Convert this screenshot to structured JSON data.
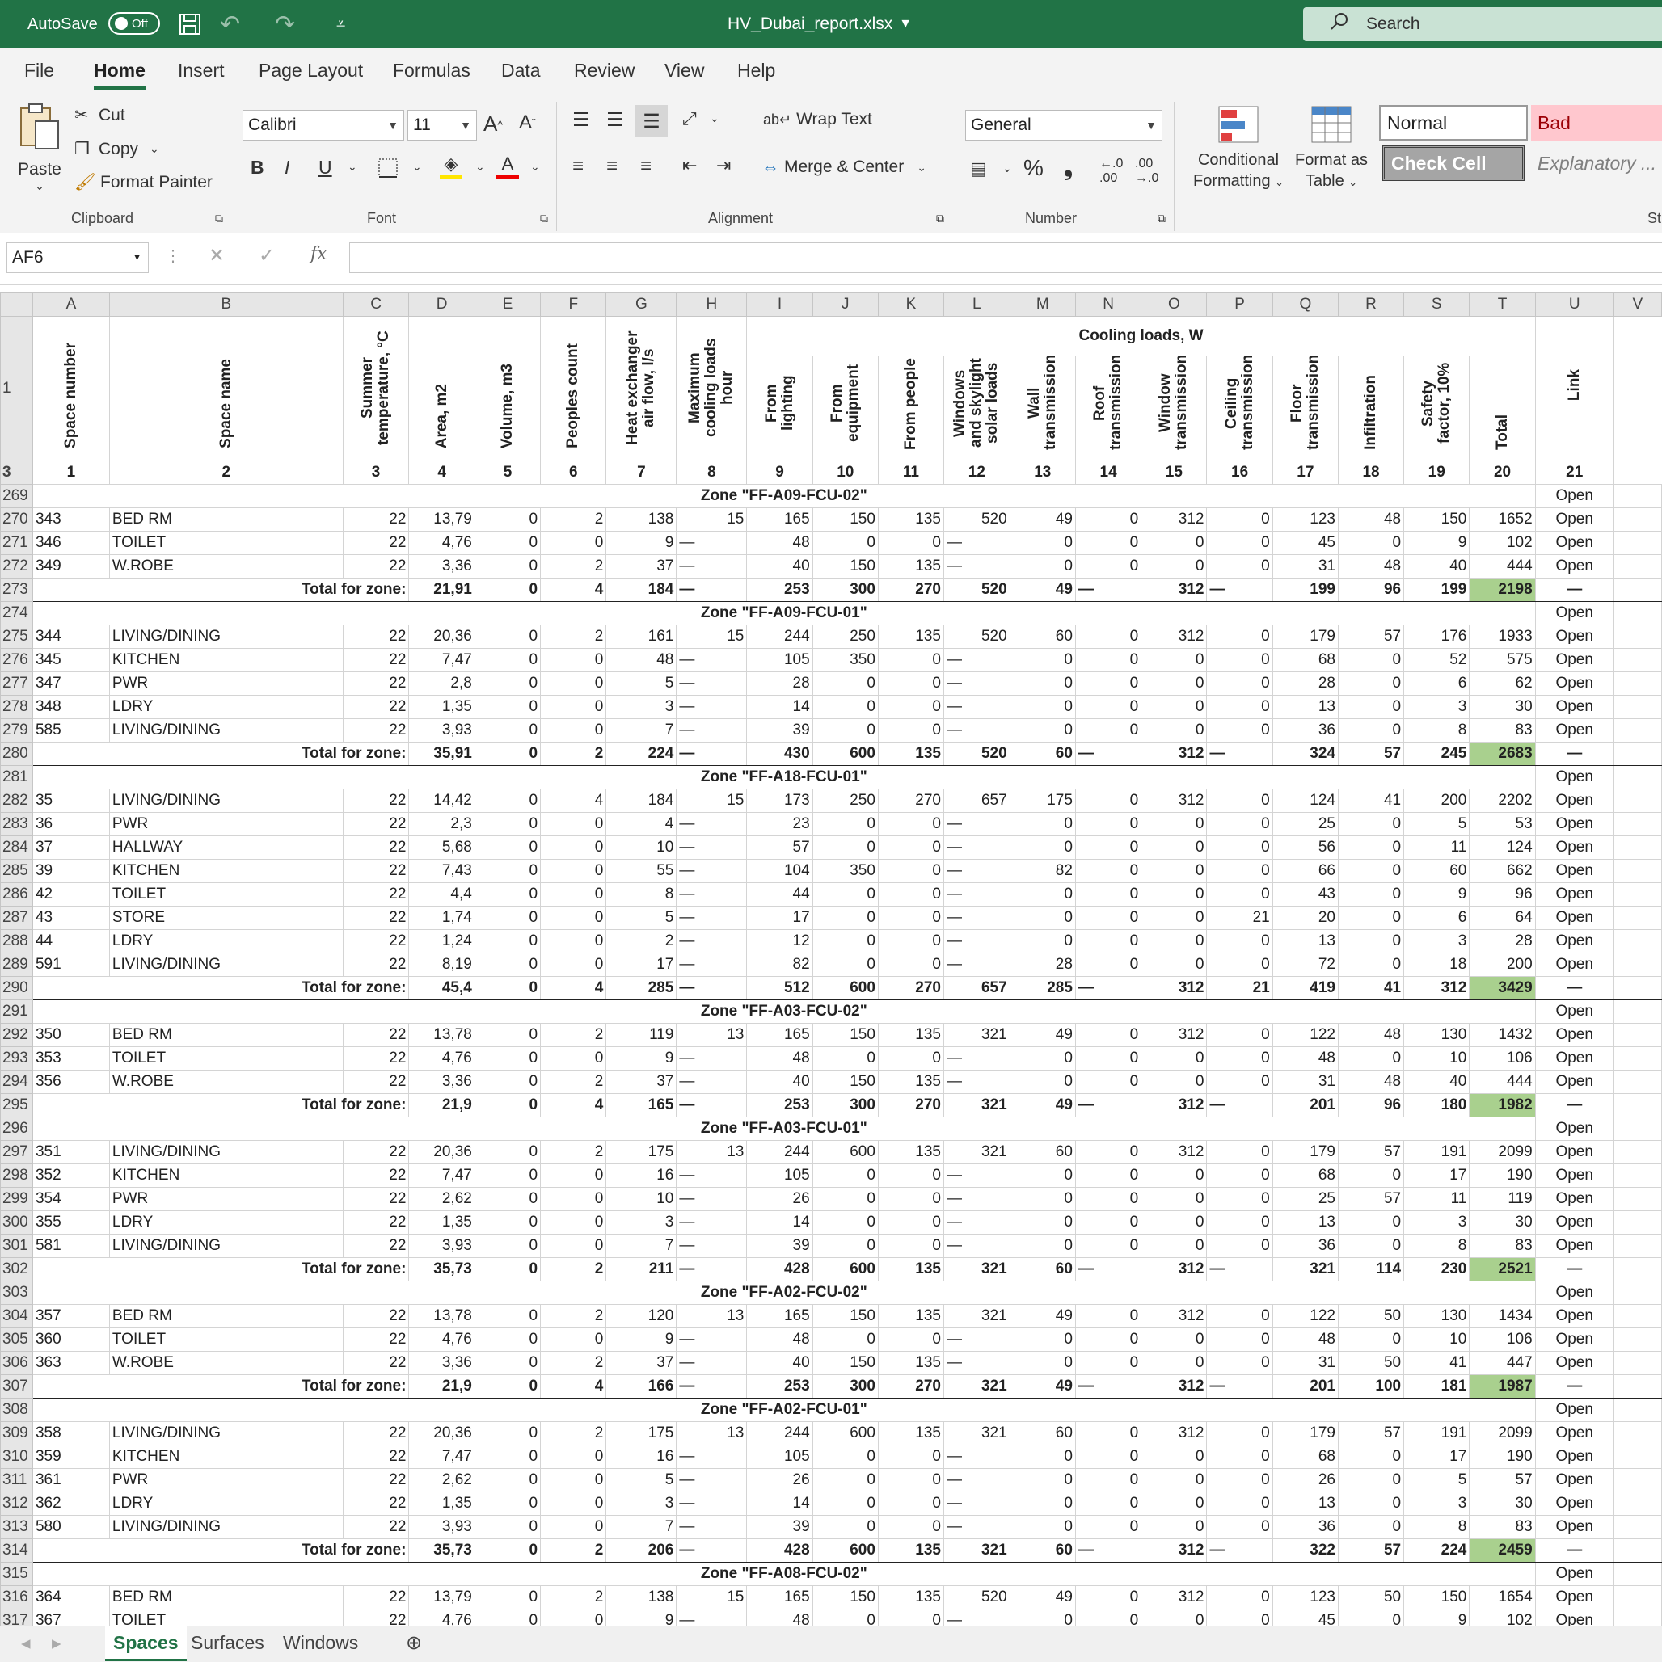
{
  "titlebar": {
    "autosave_label": "AutoSave",
    "autosave_state": "Off",
    "filename": "HV_Dubai_report.xlsx",
    "search_placeholder": "Search"
  },
  "tabs": [
    "File",
    "Home",
    "Insert",
    "Page Layout",
    "Formulas",
    "Data",
    "Review",
    "View",
    "Help"
  ],
  "ribbon": {
    "clipboard": {
      "paste": "Paste",
      "cut": "Cut",
      "copy": "Copy",
      "format_painter": "Format Painter",
      "label": "Clipboard"
    },
    "font": {
      "name": "Calibri",
      "size": "11",
      "label": "Font"
    },
    "alignment": {
      "wrap_text": "Wrap Text",
      "merge_center": "Merge & Center",
      "label": "Alignment"
    },
    "number": {
      "format": "General",
      "label": "Number"
    },
    "styles": {
      "conditional": "Conditional",
      "conditional2": "Formatting",
      "format_as": "Format as",
      "format_as2": "Table",
      "normal": "Normal",
      "bad": "Bad",
      "check_cell": "Check Cell",
      "explanatory": "Explanatory ...",
      "partial": "St"
    }
  },
  "formula": {
    "namebox": "AF6",
    "content": ""
  },
  "columns": [
    "A",
    "B",
    "C",
    "D",
    "E",
    "F",
    "G",
    "H",
    "I",
    "J",
    "K",
    "L",
    "M",
    "N",
    "O",
    "P",
    "Q",
    "R",
    "S",
    "T",
    "U",
    "V"
  ],
  "header": {
    "cooling": "Cooling loads, W",
    "labels": [
      "Space number",
      "Space name",
      "Summer temperature, °C",
      "Area, m2",
      "Volume, m3",
      "Peoples count",
      "Heat exchanger air flow, l/s",
      "Maximum cooling loads hour",
      "From lighting",
      "From equipment",
      "From people",
      "Windows and skylight solar loads",
      "Wall transmission",
      "Roof transmission",
      "Window transmission",
      "Ceiling transmission",
      "Floor transmission",
      "Infiltration",
      "Safety factor, 10%",
      "Total",
      "Link"
    ],
    "numbers": [
      "1",
      "2",
      "3",
      "4",
      "5",
      "6",
      "7",
      "8",
      "9",
      "10",
      "11",
      "12",
      "13",
      "14",
      "15",
      "16",
      "17",
      "18",
      "19",
      "20",
      "21"
    ]
  },
  "rows": [
    {
      "n": "269",
      "type": "zone",
      "title": "Zone \"FF-A09-FCU-02\"",
      "link": "Open"
    },
    {
      "n": "270",
      "type": "data",
      "v": [
        "343",
        "BED RM",
        "22",
        "13,79",
        "0",
        "2",
        "138",
        "15",
        "165",
        "150",
        "135",
        "520",
        "49",
        "0",
        "312",
        "0",
        "123",
        "48",
        "150",
        "1652",
        "Open"
      ]
    },
    {
      "n": "271",
      "type": "data",
      "v": [
        "346",
        "TOILET",
        "22",
        "4,76",
        "0",
        "0",
        "9",
        "—",
        "48",
        "0",
        "0",
        "—",
        "0",
        "0",
        "0",
        "0",
        "45",
        "0",
        "9",
        "102",
        "Open"
      ]
    },
    {
      "n": "272",
      "type": "data",
      "v": [
        "349",
        "W.ROBE",
        "22",
        "3,36",
        "0",
        "2",
        "37",
        "—",
        "40",
        "150",
        "135",
        "—",
        "0",
        "0",
        "0",
        "0",
        "31",
        "48",
        "40",
        "444",
        "Open"
      ]
    },
    {
      "n": "273",
      "type": "total",
      "label": "Total for zone:",
      "v": [
        "21,91",
        "0",
        "4",
        "184",
        "—",
        "253",
        "300",
        "270",
        "520",
        "49",
        "—",
        "312",
        "—",
        "199",
        "96",
        "199",
        "2198",
        "—"
      ]
    },
    {
      "n": "274",
      "type": "zone",
      "title": "Zone \"FF-A09-FCU-01\"",
      "link": "Open"
    },
    {
      "n": "275",
      "type": "data",
      "v": [
        "344",
        "LIVING/DINING",
        "22",
        "20,36",
        "0",
        "2",
        "161",
        "15",
        "244",
        "250",
        "135",
        "520",
        "60",
        "0",
        "312",
        "0",
        "179",
        "57",
        "176",
        "1933",
        "Open"
      ]
    },
    {
      "n": "276",
      "type": "data",
      "v": [
        "345",
        "KITCHEN",
        "22",
        "7,47",
        "0",
        "0",
        "48",
        "—",
        "105",
        "350",
        "0",
        "—",
        "0",
        "0",
        "0",
        "0",
        "68",
        "0",
        "52",
        "575",
        "Open"
      ]
    },
    {
      "n": "277",
      "type": "data",
      "v": [
        "347",
        "PWR",
        "22",
        "2,8",
        "0",
        "0",
        "5",
        "—",
        "28",
        "0",
        "0",
        "—",
        "0",
        "0",
        "0",
        "0",
        "28",
        "0",
        "6",
        "62",
        "Open"
      ]
    },
    {
      "n": "278",
      "type": "data",
      "v": [
        "348",
        "LDRY",
        "22",
        "1,35",
        "0",
        "0",
        "3",
        "—",
        "14",
        "0",
        "0",
        "—",
        "0",
        "0",
        "0",
        "0",
        "13",
        "0",
        "3",
        "30",
        "Open"
      ]
    },
    {
      "n": "279",
      "type": "data",
      "v": [
        "585",
        "LIVING/DINING",
        "22",
        "3,93",
        "0",
        "0",
        "7",
        "—",
        "39",
        "0",
        "0",
        "—",
        "0",
        "0",
        "0",
        "0",
        "36",
        "0",
        "8",
        "83",
        "Open"
      ]
    },
    {
      "n": "280",
      "type": "total",
      "label": "Total for zone:",
      "v": [
        "35,91",
        "0",
        "2",
        "224",
        "—",
        "430",
        "600",
        "135",
        "520",
        "60",
        "—",
        "312",
        "—",
        "324",
        "57",
        "245",
        "2683",
        "—"
      ]
    },
    {
      "n": "281",
      "type": "zone",
      "title": "Zone \"FF-A18-FCU-01\"",
      "link": "Open"
    },
    {
      "n": "282",
      "type": "data",
      "v": [
        "35",
        "LIVING/DINING",
        "22",
        "14,42",
        "0",
        "4",
        "184",
        "15",
        "173",
        "250",
        "270",
        "657",
        "175",
        "0",
        "312",
        "0",
        "124",
        "41",
        "200",
        "2202",
        "Open"
      ]
    },
    {
      "n": "283",
      "type": "data",
      "v": [
        "36",
        "PWR",
        "22",
        "2,3",
        "0",
        "0",
        "4",
        "—",
        "23",
        "0",
        "0",
        "—",
        "0",
        "0",
        "0",
        "0",
        "25",
        "0",
        "5",
        "53",
        "Open"
      ]
    },
    {
      "n": "284",
      "type": "data",
      "v": [
        "37",
        "HALLWAY",
        "22",
        "5,68",
        "0",
        "0",
        "10",
        "—",
        "57",
        "0",
        "0",
        "—",
        "0",
        "0",
        "0",
        "0",
        "56",
        "0",
        "11",
        "124",
        "Open"
      ]
    },
    {
      "n": "285",
      "type": "data",
      "v": [
        "39",
        "KITCHEN",
        "22",
        "7,43",
        "0",
        "0",
        "55",
        "—",
        "104",
        "350",
        "0",
        "—",
        "82",
        "0",
        "0",
        "0",
        "66",
        "0",
        "60",
        "662",
        "Open"
      ]
    },
    {
      "n": "286",
      "type": "data",
      "v": [
        "42",
        "TOILET",
        "22",
        "4,4",
        "0",
        "0",
        "8",
        "—",
        "44",
        "0",
        "0",
        "—",
        "0",
        "0",
        "0",
        "0",
        "43",
        "0",
        "9",
        "96",
        "Open"
      ]
    },
    {
      "n": "287",
      "type": "data",
      "v": [
        "43",
        "STORE",
        "22",
        "1,74",
        "0",
        "0",
        "5",
        "—",
        "17",
        "0",
        "0",
        "—",
        "0",
        "0",
        "0",
        "21",
        "20",
        "0",
        "6",
        "64",
        "Open"
      ]
    },
    {
      "n": "288",
      "type": "data",
      "v": [
        "44",
        "LDRY",
        "22",
        "1,24",
        "0",
        "0",
        "2",
        "—",
        "12",
        "0",
        "0",
        "—",
        "0",
        "0",
        "0",
        "0",
        "13",
        "0",
        "3",
        "28",
        "Open"
      ]
    },
    {
      "n": "289",
      "type": "data",
      "v": [
        "591",
        "LIVING/DINING",
        "22",
        "8,19",
        "0",
        "0",
        "17",
        "—",
        "82",
        "0",
        "0",
        "—",
        "28",
        "0",
        "0",
        "0",
        "72",
        "0",
        "18",
        "200",
        "Open"
      ]
    },
    {
      "n": "290",
      "type": "total",
      "label": "Total for zone:",
      "v": [
        "45,4",
        "0",
        "4",
        "285",
        "—",
        "512",
        "600",
        "270",
        "657",
        "285",
        "—",
        "312",
        "21",
        "419",
        "41",
        "312",
        "3429",
        "—"
      ]
    },
    {
      "n": "291",
      "type": "zone",
      "title": "Zone \"FF-A03-FCU-02\"",
      "link": "Open"
    },
    {
      "n": "292",
      "type": "data",
      "v": [
        "350",
        "BED RM",
        "22",
        "13,78",
        "0",
        "2",
        "119",
        "13",
        "165",
        "150",
        "135",
        "321",
        "49",
        "0",
        "312",
        "0",
        "122",
        "48",
        "130",
        "1432",
        "Open"
      ]
    },
    {
      "n": "293",
      "type": "data",
      "v": [
        "353",
        "TOILET",
        "22",
        "4,76",
        "0",
        "0",
        "9",
        "—",
        "48",
        "0",
        "0",
        "—",
        "0",
        "0",
        "0",
        "0",
        "48",
        "0",
        "10",
        "106",
        "Open"
      ]
    },
    {
      "n": "294",
      "type": "data",
      "v": [
        "356",
        "W.ROBE",
        "22",
        "3,36",
        "0",
        "2",
        "37",
        "—",
        "40",
        "150",
        "135",
        "—",
        "0",
        "0",
        "0",
        "0",
        "31",
        "48",
        "40",
        "444",
        "Open"
      ]
    },
    {
      "n": "295",
      "type": "total",
      "label": "Total for zone:",
      "v": [
        "21,9",
        "0",
        "4",
        "165",
        "—",
        "253",
        "300",
        "270",
        "321",
        "49",
        "—",
        "312",
        "—",
        "201",
        "96",
        "180",
        "1982",
        "—"
      ]
    },
    {
      "n": "296",
      "type": "zone",
      "title": "Zone \"FF-A03-FCU-01\"",
      "link": "Open"
    },
    {
      "n": "297",
      "type": "data",
      "v": [
        "351",
        "LIVING/DINING",
        "22",
        "20,36",
        "0",
        "2",
        "175",
        "13",
        "244",
        "600",
        "135",
        "321",
        "60",
        "0",
        "312",
        "0",
        "179",
        "57",
        "191",
        "2099",
        "Open"
      ]
    },
    {
      "n": "298",
      "type": "data",
      "v": [
        "352",
        "KITCHEN",
        "22",
        "7,47",
        "0",
        "0",
        "16",
        "—",
        "105",
        "0",
        "0",
        "—",
        "0",
        "0",
        "0",
        "0",
        "68",
        "0",
        "17",
        "190",
        "Open"
      ]
    },
    {
      "n": "299",
      "type": "data",
      "v": [
        "354",
        "PWR",
        "22",
        "2,62",
        "0",
        "0",
        "10",
        "—",
        "26",
        "0",
        "0",
        "—",
        "0",
        "0",
        "0",
        "0",
        "25",
        "57",
        "11",
        "119",
        "Open"
      ]
    },
    {
      "n": "300",
      "type": "data",
      "v": [
        "355",
        "LDRY",
        "22",
        "1,35",
        "0",
        "0",
        "3",
        "—",
        "14",
        "0",
        "0",
        "—",
        "0",
        "0",
        "0",
        "0",
        "13",
        "0",
        "3",
        "30",
        "Open"
      ]
    },
    {
      "n": "301",
      "type": "data",
      "v": [
        "581",
        "LIVING/DINING",
        "22",
        "3,93",
        "0",
        "0",
        "7",
        "—",
        "39",
        "0",
        "0",
        "—",
        "0",
        "0",
        "0",
        "0",
        "36",
        "0",
        "8",
        "83",
        "Open"
      ]
    },
    {
      "n": "302",
      "type": "total",
      "label": "Total for zone:",
      "v": [
        "35,73",
        "0",
        "2",
        "211",
        "—",
        "428",
        "600",
        "135",
        "321",
        "60",
        "—",
        "312",
        "—",
        "321",
        "114",
        "230",
        "2521",
        "—"
      ]
    },
    {
      "n": "303",
      "type": "zone",
      "title": "Zone \"FF-A02-FCU-02\"",
      "link": "Open"
    },
    {
      "n": "304",
      "type": "data",
      "v": [
        "357",
        "BED RM",
        "22",
        "13,78",
        "0",
        "2",
        "120",
        "13",
        "165",
        "150",
        "135",
        "321",
        "49",
        "0",
        "312",
        "0",
        "122",
        "50",
        "130",
        "1434",
        "Open"
      ]
    },
    {
      "n": "305",
      "type": "data",
      "v": [
        "360",
        "TOILET",
        "22",
        "4,76",
        "0",
        "0",
        "9",
        "—",
        "48",
        "0",
        "0",
        "—",
        "0",
        "0",
        "0",
        "0",
        "48",
        "0",
        "10",
        "106",
        "Open"
      ]
    },
    {
      "n": "306",
      "type": "data",
      "v": [
        "363",
        "W.ROBE",
        "22",
        "3,36",
        "0",
        "2",
        "37",
        "—",
        "40",
        "150",
        "135",
        "—",
        "0",
        "0",
        "0",
        "0",
        "31",
        "50",
        "41",
        "447",
        "Open"
      ]
    },
    {
      "n": "307",
      "type": "total",
      "label": "Total for zone:",
      "v": [
        "21,9",
        "0",
        "4",
        "166",
        "—",
        "253",
        "300",
        "270",
        "321",
        "49",
        "—",
        "312",
        "—",
        "201",
        "100",
        "181",
        "1987",
        "—"
      ]
    },
    {
      "n": "308",
      "type": "zone",
      "title": "Zone \"FF-A02-FCU-01\"",
      "link": "Open"
    },
    {
      "n": "309",
      "type": "data",
      "v": [
        "358",
        "LIVING/DINING",
        "22",
        "20,36",
        "0",
        "2",
        "175",
        "13",
        "244",
        "600",
        "135",
        "321",
        "60",
        "0",
        "312",
        "0",
        "179",
        "57",
        "191",
        "2099",
        "Open"
      ]
    },
    {
      "n": "310",
      "type": "data",
      "v": [
        "359",
        "KITCHEN",
        "22",
        "7,47",
        "0",
        "0",
        "16",
        "—",
        "105",
        "0",
        "0",
        "—",
        "0",
        "0",
        "0",
        "0",
        "68",
        "0",
        "17",
        "190",
        "Open"
      ]
    },
    {
      "n": "311",
      "type": "data",
      "v": [
        "361",
        "PWR",
        "22",
        "2,62",
        "0",
        "0",
        "5",
        "—",
        "26",
        "0",
        "0",
        "—",
        "0",
        "0",
        "0",
        "0",
        "26",
        "0",
        "5",
        "57",
        "Open"
      ]
    },
    {
      "n": "312",
      "type": "data",
      "v": [
        "362",
        "LDRY",
        "22",
        "1,35",
        "0",
        "0",
        "3",
        "—",
        "14",
        "0",
        "0",
        "—",
        "0",
        "0",
        "0",
        "0",
        "13",
        "0",
        "3",
        "30",
        "Open"
      ]
    },
    {
      "n": "313",
      "type": "data",
      "v": [
        "580",
        "LIVING/DINING",
        "22",
        "3,93",
        "0",
        "0",
        "7",
        "—",
        "39",
        "0",
        "0",
        "—",
        "0",
        "0",
        "0",
        "0",
        "36",
        "0",
        "8",
        "83",
        "Open"
      ]
    },
    {
      "n": "314",
      "type": "total",
      "label": "Total for zone:",
      "v": [
        "35,73",
        "0",
        "2",
        "206",
        "—",
        "428",
        "600",
        "135",
        "321",
        "60",
        "—",
        "312",
        "—",
        "322",
        "57",
        "224",
        "2459",
        "—"
      ]
    },
    {
      "n": "315",
      "type": "zone",
      "title": "Zone \"FF-A08-FCU-02\"",
      "link": "Open"
    },
    {
      "n": "316",
      "type": "data",
      "v": [
        "364",
        "BED RM",
        "22",
        "13,79",
        "0",
        "2",
        "138",
        "15",
        "165",
        "150",
        "135",
        "520",
        "49",
        "0",
        "312",
        "0",
        "123",
        "50",
        "150",
        "1654",
        "Open"
      ]
    },
    {
      "n": "317",
      "type": "data",
      "v": [
        "367",
        "TOILET",
        "22",
        "4,76",
        "0",
        "0",
        "9",
        "—",
        "48",
        "0",
        "0",
        "—",
        "0",
        "0",
        "0",
        "0",
        "45",
        "0",
        "9",
        "102",
        "Open"
      ]
    }
  ],
  "sheets": [
    "Spaces",
    "Surfaces",
    "Windows"
  ],
  "colors": {
    "brand": "#217346",
    "total_highlight": "#a9d08e",
    "bad_bg": "#ffc7ce",
    "bad_text": "#9c0006",
    "check_bg": "#a5a5a5"
  }
}
